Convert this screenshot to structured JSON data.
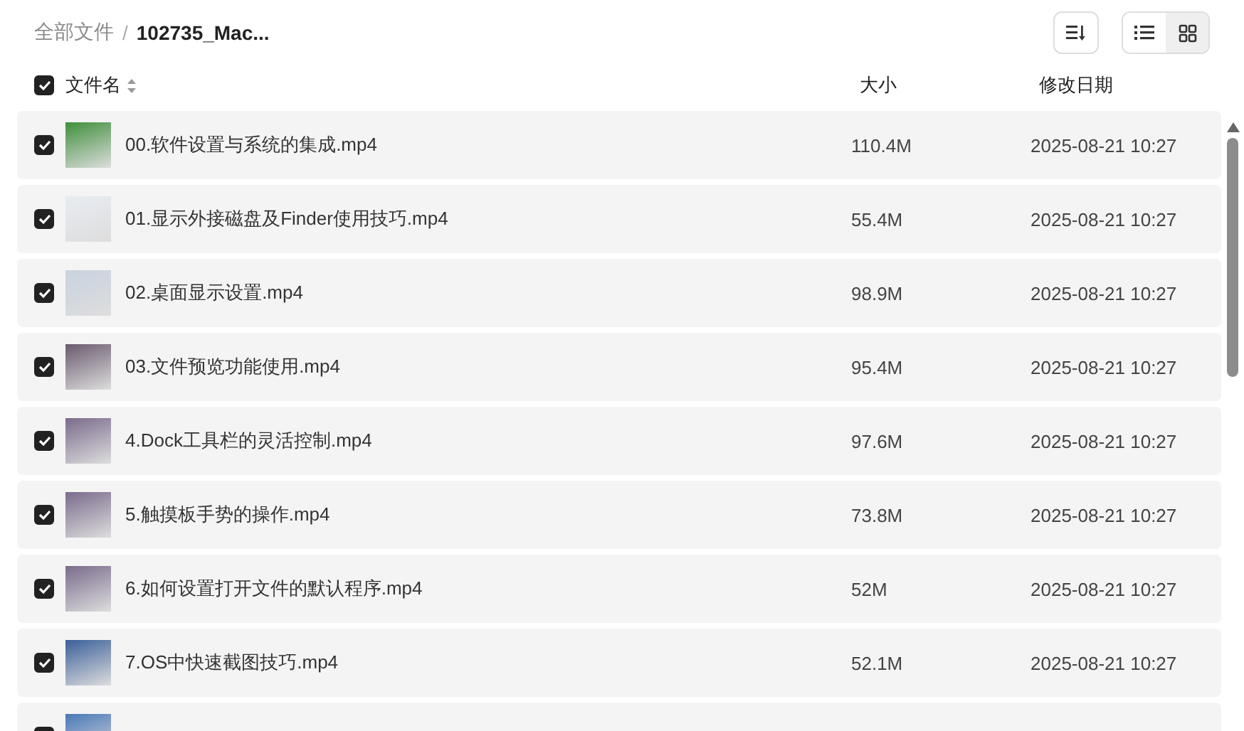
{
  "breadcrumb_separator": "/",
  "breadcrumb": [
    {
      "label": "全部文件",
      "current": false
    },
    {
      "label": "102735_Mac...",
      "current": true
    }
  ],
  "toolbar": {
    "view_modes": [
      {
        "kind": "list",
        "selected": false
      },
      {
        "kind": "grid",
        "selected": true
      }
    ]
  },
  "table": {
    "select_all": {
      "checked": true
    },
    "columns": [
      {
        "label": "文件名",
        "sortable": true
      },
      {
        "label": "大小",
        "sortable": false
      },
      {
        "label": "修改日期",
        "sortable": false
      }
    ],
    "rows": [
      {
        "checked": true,
        "name": "00.软件设置与系统的集成.mp4",
        "size": "110.4M",
        "modified": "2025-08-21 10:27"
      },
      {
        "checked": true,
        "name": "01.显示外接磁盘及Finder使用技巧.mp4",
        "size": "55.4M",
        "modified": "2025-08-21 10:27"
      },
      {
        "checked": true,
        "name": "02.桌面显示设置.mp4",
        "size": "98.9M",
        "modified": "2025-08-21 10:27"
      },
      {
        "checked": true,
        "name": "03.文件预览功能使用.mp4",
        "size": "95.4M",
        "modified": "2025-08-21 10:27"
      },
      {
        "checked": true,
        "name": "4.Dock工具栏的灵活控制.mp4",
        "size": "97.6M",
        "modified": "2025-08-21 10:27"
      },
      {
        "checked": true,
        "name": "5.触摸板手势的操作.mp4",
        "size": "73.8M",
        "modified": "2025-08-21 10:27"
      },
      {
        "checked": true,
        "name": "6.如何设置打开文件的默认程序.mp4",
        "size": "52M",
        "modified": "2025-08-21 10:27"
      },
      {
        "checked": true,
        "name": "7.OS中快速截图技巧.mp4",
        "size": "52.1M",
        "modified": "2025-08-21 10:27"
      },
      {
        "checked": true
      }
    ]
  }
}
